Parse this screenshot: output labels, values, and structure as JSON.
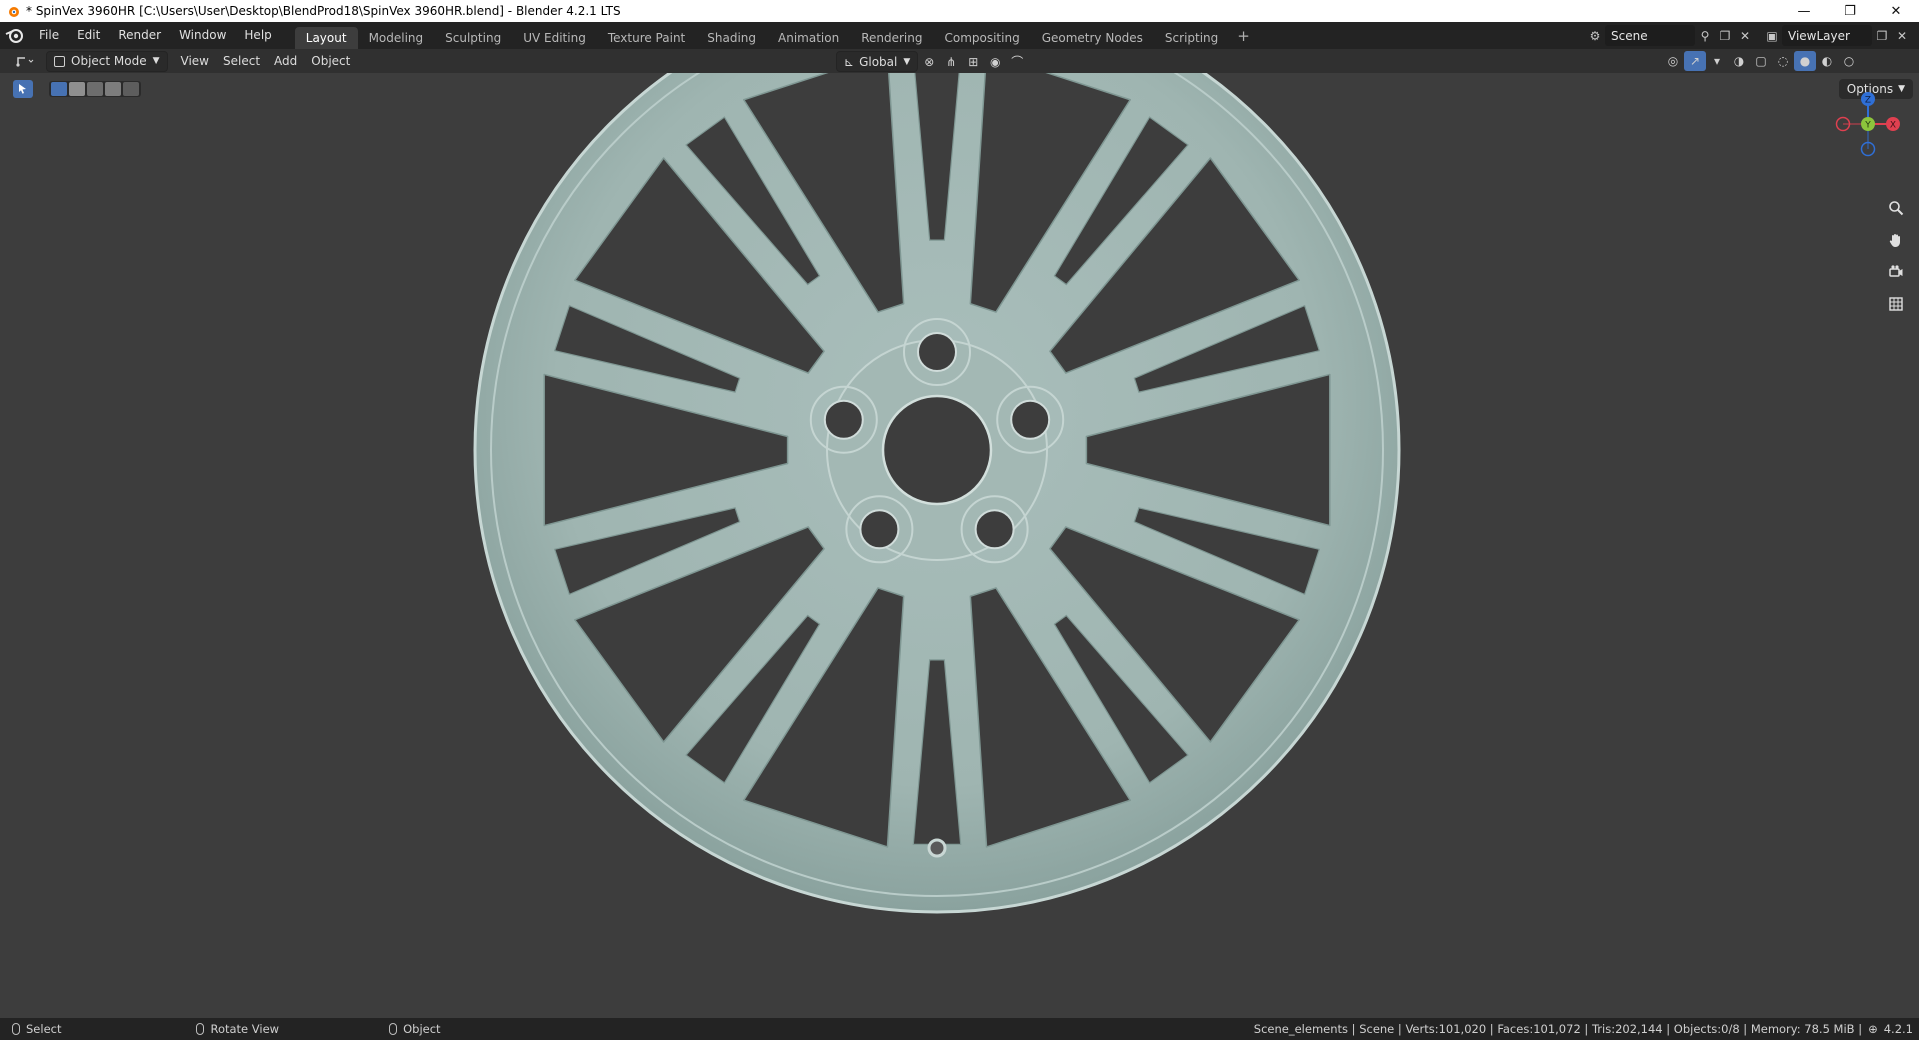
{
  "window": {
    "title": "* SpinVex 3960HR [C:\\Users\\User\\Desktop\\BlendProd18\\SpinVex 3960HR.blend] - Blender 4.2.1 LTS",
    "minimize": "—",
    "restore": "❐",
    "close": "✕"
  },
  "menu": [
    "File",
    "Edit",
    "Render",
    "Window",
    "Help"
  ],
  "workspaces": [
    "Layout",
    "Modeling",
    "Sculpting",
    "UV Editing",
    "Texture Paint",
    "Shading",
    "Animation",
    "Rendering",
    "Compositing",
    "Geometry Nodes",
    "Scripting"
  ],
  "active_workspace": "Layout",
  "scene": {
    "name": "Scene"
  },
  "view_layer": {
    "name": "ViewLayer"
  },
  "header": {
    "mode": "Object Mode",
    "menus": [
      "View",
      "Select",
      "Add",
      "Object"
    ],
    "transform_orientation": "Global"
  },
  "viewport": {
    "options_label": "Options",
    "gizmo": {
      "z": "Z",
      "y": "Y",
      "x": "X"
    },
    "colors": {
      "background": "#3d3d3d",
      "model": "#9fb5b1",
      "accent": "#4772b3"
    },
    "icons": [
      "zoom-icon",
      "hand-pan-icon",
      "camera-icon",
      "grid-icon"
    ]
  },
  "status": {
    "select": "Select",
    "rotate": "Rotate View",
    "object": "Object",
    "stats": "Scene_elements | Scene | Verts:101,020 | Faces:101,072 | Tris:202,144 | Objects:0/8 | Memory: 78.5 MiB |",
    "version": "4.2.1"
  }
}
